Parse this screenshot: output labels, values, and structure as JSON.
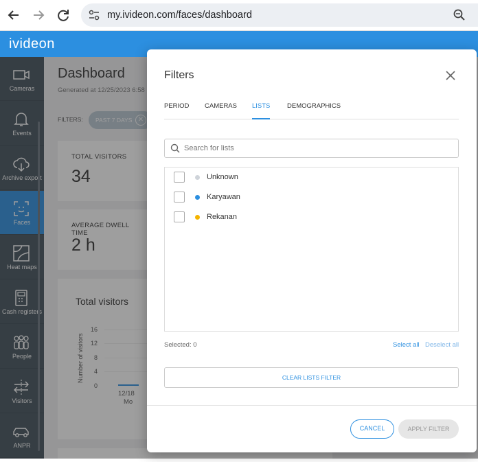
{
  "browser": {
    "url": "my.ivideon.com/faces/dashboard"
  },
  "app": {
    "logo": "ivideon"
  },
  "sidebar": {
    "items": [
      {
        "label": "Cameras",
        "icon": "camera-icon"
      },
      {
        "label": "Events",
        "icon": "bell-icon"
      },
      {
        "label": "Archive export",
        "icon": "cloud-download-icon"
      },
      {
        "label": "Faces",
        "icon": "face-scan-icon",
        "active": true
      },
      {
        "label": "Heat maps",
        "icon": "heat-map-icon"
      },
      {
        "label": "Cash registers",
        "icon": "cash-register-icon"
      },
      {
        "label": "People",
        "icon": "people-icon"
      },
      {
        "label": "Visitors",
        "icon": "visitors-arrows-icon"
      },
      {
        "label": "ANPR",
        "icon": "car-icon"
      }
    ]
  },
  "dashboard": {
    "title": "Dashboard",
    "generated": "Generated at 12/25/2023 6:58",
    "filters_label": "FILTERS:",
    "filter_chip": "PAST 7 DAYS",
    "total_visitors_label": "TOTAL VISITORS",
    "total_visitors_value": "34",
    "dwell_label": "AVERAGE DWELL TIME",
    "dwell_value": "2 h",
    "chart": {
      "title": "Total visitors",
      "ylabel": "Number of visitors",
      "yticks": [
        "16",
        "12",
        "8",
        "4",
        "0"
      ],
      "xtick_date": "12/18",
      "xtick_day": "Mo"
    }
  },
  "modal": {
    "title": "Filters",
    "tabs": [
      "PERIOD",
      "CAMERAS",
      "LISTS",
      "DEMOGRAPHICS"
    ],
    "active_tab": "LISTS",
    "search_placeholder": "Search for lists",
    "lists": [
      {
        "name": "Unknown",
        "color": "#cfd4da",
        "checked": false
      },
      {
        "name": "Karyawan",
        "color": "#2c8fe0",
        "checked": false
      },
      {
        "name": "Rekanan",
        "color": "#f5b400",
        "checked": false
      }
    ],
    "selected_text": "Selected: 0",
    "select_all": "Select all",
    "deselect_all": "Deselect all",
    "clear_button": "CLEAR LISTS FILTER",
    "cancel_button": "CANCEL",
    "apply_button": "APPLY FILTER"
  },
  "colors": {
    "accent": "#2c8fe0",
    "sidebar": "#43505c"
  }
}
